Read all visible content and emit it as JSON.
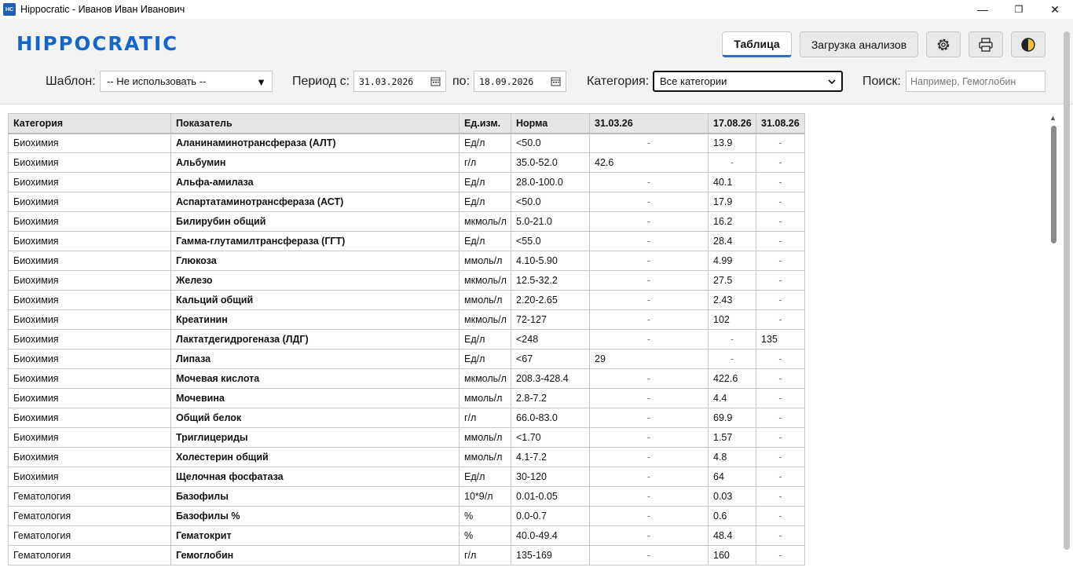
{
  "window": {
    "title": "Hippocratic - Иванов Иван Иванович",
    "app_icon": "HC",
    "min": "—",
    "max": "❐",
    "close": "✕"
  },
  "header": {
    "logo": "HIPPOCRATIC",
    "tab_table": "Таблица",
    "tab_upload": "Загрузка анализов",
    "icons": [
      "gear-icon",
      "printer-icon",
      "theme-icon"
    ]
  },
  "filters": {
    "template_label": "Шаблон:",
    "template_value": "-- Не использовать --",
    "period_label": "Период с:",
    "date_from": "31.03.2026",
    "to_label": "по:",
    "date_to": "18.09.2026",
    "category_label": "Категория:",
    "category_value": "Все категории",
    "search_label": "Поиск:",
    "search_placeholder": "Например, Гемоглобин"
  },
  "table": {
    "headers": [
      "Категория",
      "Показатель",
      "Ед.изм.",
      "Норма",
      "31.03.26",
      "17.08.26",
      "31.08.26"
    ],
    "rows": [
      [
        "Биохимия",
        "Аланинаминотрансфераза (АЛТ)",
        "Ед/л",
        "<50.0",
        "-",
        "13.9",
        "-"
      ],
      [
        "Биохимия",
        "Альбумин",
        "г/л",
        "35.0-52.0",
        "42.6",
        "-",
        "-"
      ],
      [
        "Биохимия",
        "Альфа-амилаза",
        "Ед/л",
        "28.0-100.0",
        "-",
        "40.1",
        "-"
      ],
      [
        "Биохимия",
        "Аспартатаминотрансфераза (АСТ)",
        "Ед/л",
        "<50.0",
        "-",
        "17.9",
        "-"
      ],
      [
        "Биохимия",
        "Билирубин общий",
        "мкмоль/л",
        "5.0-21.0",
        "-",
        "16.2",
        "-"
      ],
      [
        "Биохимия",
        "Гамма-глутамилтрансфераза (ГГТ)",
        "Ед/л",
        "<55.0",
        "-",
        "28.4",
        "-"
      ],
      [
        "Биохимия",
        "Глюкоза",
        "ммоль/л",
        "4.10-5.90",
        "-",
        "4.99",
        "-"
      ],
      [
        "Биохимия",
        "Железо",
        "мкмоль/л",
        "12.5-32.2",
        "-",
        "27.5",
        "-"
      ],
      [
        "Биохимия",
        "Кальций общий",
        "ммоль/л",
        "2.20-2.65",
        "-",
        "2.43",
        "-"
      ],
      [
        "Биохимия",
        "Креатинин",
        "мкмоль/л",
        "72-127",
        "-",
        "102",
        "-"
      ],
      [
        "Биохимия",
        "Лактатдегидрогеназа (ЛДГ)",
        "Ед/л",
        "<248",
        "-",
        "-",
        "135"
      ],
      [
        "Биохимия",
        "Липаза",
        "Ед/л",
        "<67",
        "29",
        "-",
        "-"
      ],
      [
        "Биохимия",
        "Мочевая кислота",
        "мкмоль/л",
        "208.3-428.4",
        "-",
        "422.6",
        "-"
      ],
      [
        "Биохимия",
        "Мочевина",
        "ммоль/л",
        "2.8-7.2",
        "-",
        "4.4",
        "-"
      ],
      [
        "Биохимия",
        "Общий белок",
        "г/л",
        "66.0-83.0",
        "-",
        "69.9",
        "-"
      ],
      [
        "Биохимия",
        "Триглицериды",
        "ммоль/л",
        "<1.70",
        "-",
        "1.57",
        "-"
      ],
      [
        "Биохимия",
        "Холестерин общий",
        "ммоль/л",
        "4.1-7.2",
        "-",
        "4.8",
        "-"
      ],
      [
        "Биохимия",
        "Щелочная фосфатаза",
        "Ед/л",
        "30-120",
        "-",
        "64",
        "-"
      ],
      [
        "Гематология",
        "Базофилы",
        "10*9/л",
        "0.01-0.05",
        "-",
        "0.03",
        "-"
      ],
      [
        "Гематология",
        "Базофилы %",
        "%",
        "0.0-0.7",
        "-",
        "0.6",
        "-"
      ],
      [
        "Гематология",
        "Гематокрит",
        "%",
        "40.0-49.4",
        "-",
        "48.4",
        "-"
      ],
      [
        "Гематология",
        "Гемоглобин",
        "г/л",
        "135-169",
        "-",
        "160",
        "-"
      ]
    ]
  }
}
